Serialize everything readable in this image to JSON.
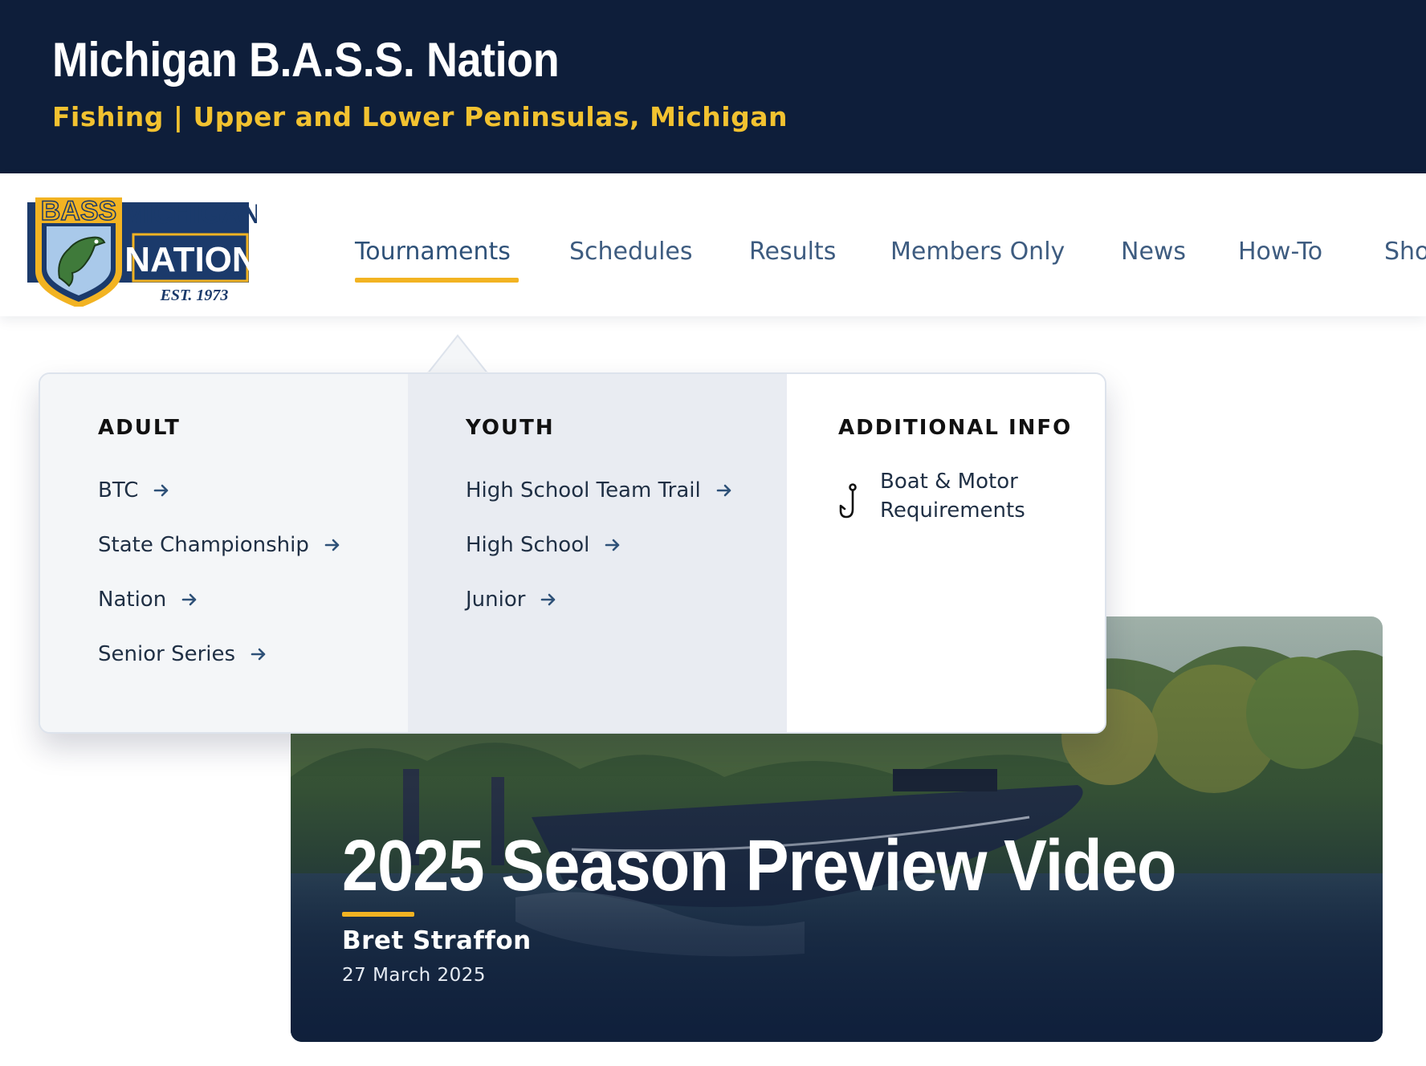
{
  "header": {
    "title": "Michigan B.A.S.S. Nation",
    "tagline": "Fishing | Upper and Lower Peninsulas, Michigan"
  },
  "logo": {
    "top_text": "MICHIGAN",
    "main_text": "NATION",
    "badge_text": "BASS",
    "est_text": "EST. 1973"
  },
  "nav": {
    "items": [
      {
        "label": "Tournaments",
        "active": true
      },
      {
        "label": "Schedules"
      },
      {
        "label": "Results"
      },
      {
        "label": "Members Only"
      },
      {
        "label": "News"
      },
      {
        "label": "How-To"
      },
      {
        "label": "Sho"
      }
    ]
  },
  "dropdown": {
    "adult": {
      "heading": "ADULT",
      "links": [
        "BTC",
        "State Championship",
        "Nation",
        "Senior Series"
      ]
    },
    "youth": {
      "heading": "YOUTH",
      "links": [
        "High School Team Trail",
        "High School",
        "Junior"
      ]
    },
    "additional": {
      "heading": "ADDITIONAL INFO",
      "link_line1": "Boat & Motor",
      "link_line2": "Requirements",
      "icon": "fishing-hook-icon"
    }
  },
  "hero": {
    "title": "2025 Season Preview Video",
    "author": "Bret Straffon",
    "date": "27 March 2025"
  },
  "colors": {
    "navy": "#0e1e3a",
    "gold": "#f2c230",
    "nav_text": "#3e5c80",
    "accent": "#f2b322"
  }
}
